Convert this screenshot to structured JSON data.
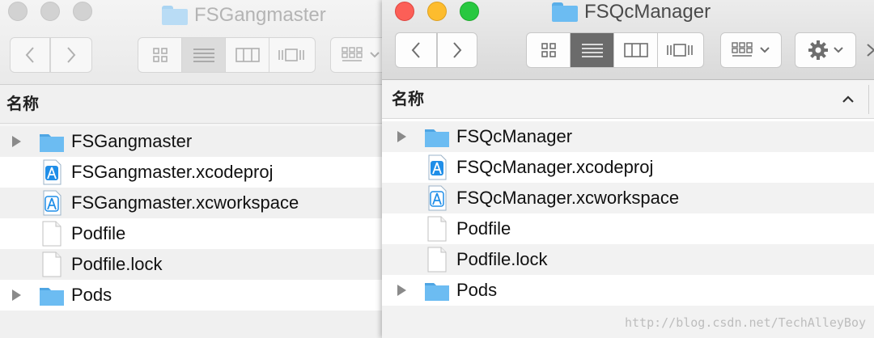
{
  "left_window": {
    "title": "FSGangmaster",
    "column_header": "名称",
    "items": [
      {
        "label": "FSGangmaster",
        "icon": "folder-icon",
        "expandable": true
      },
      {
        "label": "FSGangmaster.xcodeproj",
        "icon": "xcodeproj-icon",
        "expandable": false
      },
      {
        "label": "FSGangmaster.xcworkspace",
        "icon": "xcworkspace-icon",
        "expandable": false
      },
      {
        "label": "Podfile",
        "icon": "document-icon",
        "expandable": false
      },
      {
        "label": "Podfile.lock",
        "icon": "document-icon",
        "expandable": false
      },
      {
        "label": "Pods",
        "icon": "folder-icon",
        "expandable": true
      }
    ]
  },
  "right_window": {
    "title": "FSQcManager",
    "column_header": "名称",
    "items": [
      {
        "label": "FSQcManager",
        "icon": "folder-icon",
        "expandable": true
      },
      {
        "label": "FSQcManager.xcodeproj",
        "icon": "xcodeproj-icon",
        "expandable": false
      },
      {
        "label": "FSQcManager.xcworkspace",
        "icon": "xcworkspace-icon",
        "expandable": false
      },
      {
        "label": "Podfile",
        "icon": "document-icon",
        "expandable": false
      },
      {
        "label": "Podfile.lock",
        "icon": "document-icon",
        "expandable": false
      },
      {
        "label": "Pods",
        "icon": "folder-icon",
        "expandable": true
      }
    ]
  },
  "watermark": "http://blog.csdn.net/TechAlleyBoy",
  "colors": {
    "close": "#fc5f57",
    "minimize": "#fdbc2e",
    "zoom": "#28c840",
    "folder": "#6cbcf2",
    "active_segment": "#6b6b6b"
  }
}
